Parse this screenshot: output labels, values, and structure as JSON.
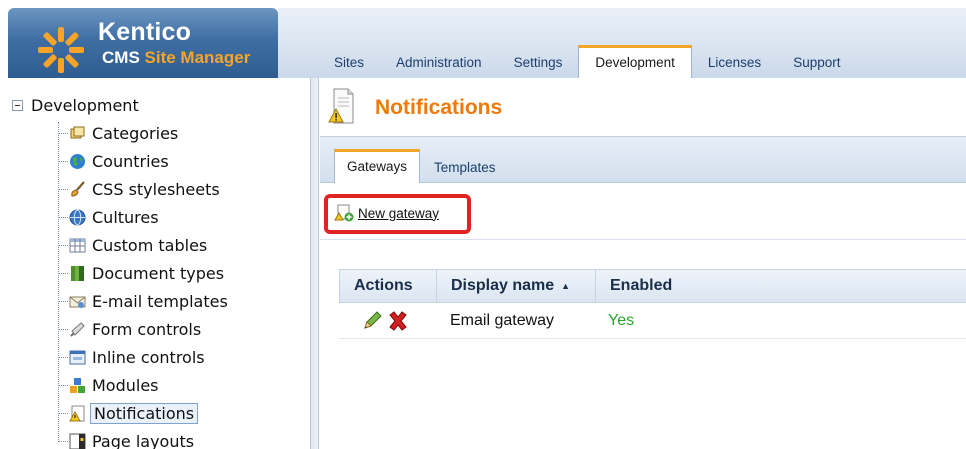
{
  "app": {
    "brand": "Kentico",
    "product_prefix": "CMS",
    "product_accent": "Site Manager"
  },
  "top_tabs": [
    {
      "label": "Sites"
    },
    {
      "label": "Administration"
    },
    {
      "label": "Settings"
    },
    {
      "label": "Development",
      "active": true
    },
    {
      "label": "Licenses"
    },
    {
      "label": "Support"
    }
  ],
  "sidebar": {
    "root_label": "Development",
    "items": [
      {
        "label": "Categories",
        "icon": "categories-icon"
      },
      {
        "label": "Countries",
        "icon": "globe-icon"
      },
      {
        "label": "CSS stylesheets",
        "icon": "brush-icon"
      },
      {
        "label": "Cultures",
        "icon": "culture-globe-icon"
      },
      {
        "label": "Custom tables",
        "icon": "table-icon"
      },
      {
        "label": "Document types",
        "icon": "document-types-icon"
      },
      {
        "label": "E-mail templates",
        "icon": "email-template-icon"
      },
      {
        "label": "Form controls",
        "icon": "form-controls-icon"
      },
      {
        "label": "Inline controls",
        "icon": "inline-controls-icon"
      },
      {
        "label": "Modules",
        "icon": "modules-icon"
      },
      {
        "label": "Notifications",
        "icon": "notifications-icon",
        "selected": true
      },
      {
        "label": "Page layouts",
        "icon": "page-layouts-icon"
      }
    ]
  },
  "page": {
    "title": "Notifications",
    "tabs": [
      {
        "label": "Gateways",
        "active": true
      },
      {
        "label": "Templates"
      }
    ],
    "new_gateway_label": "New gateway",
    "grid": {
      "columns": [
        "Actions",
        "Display name",
        "Enabled"
      ],
      "sorted_column": "Display name",
      "rows": [
        {
          "display_name": "Email gateway",
          "enabled": "Yes"
        }
      ]
    }
  },
  "colors": {
    "accent_orange": "#ef7a0a",
    "tab_highlight": "#f2a526",
    "enabled_green": "#2aa52a",
    "highlight_red": "#e02424"
  }
}
